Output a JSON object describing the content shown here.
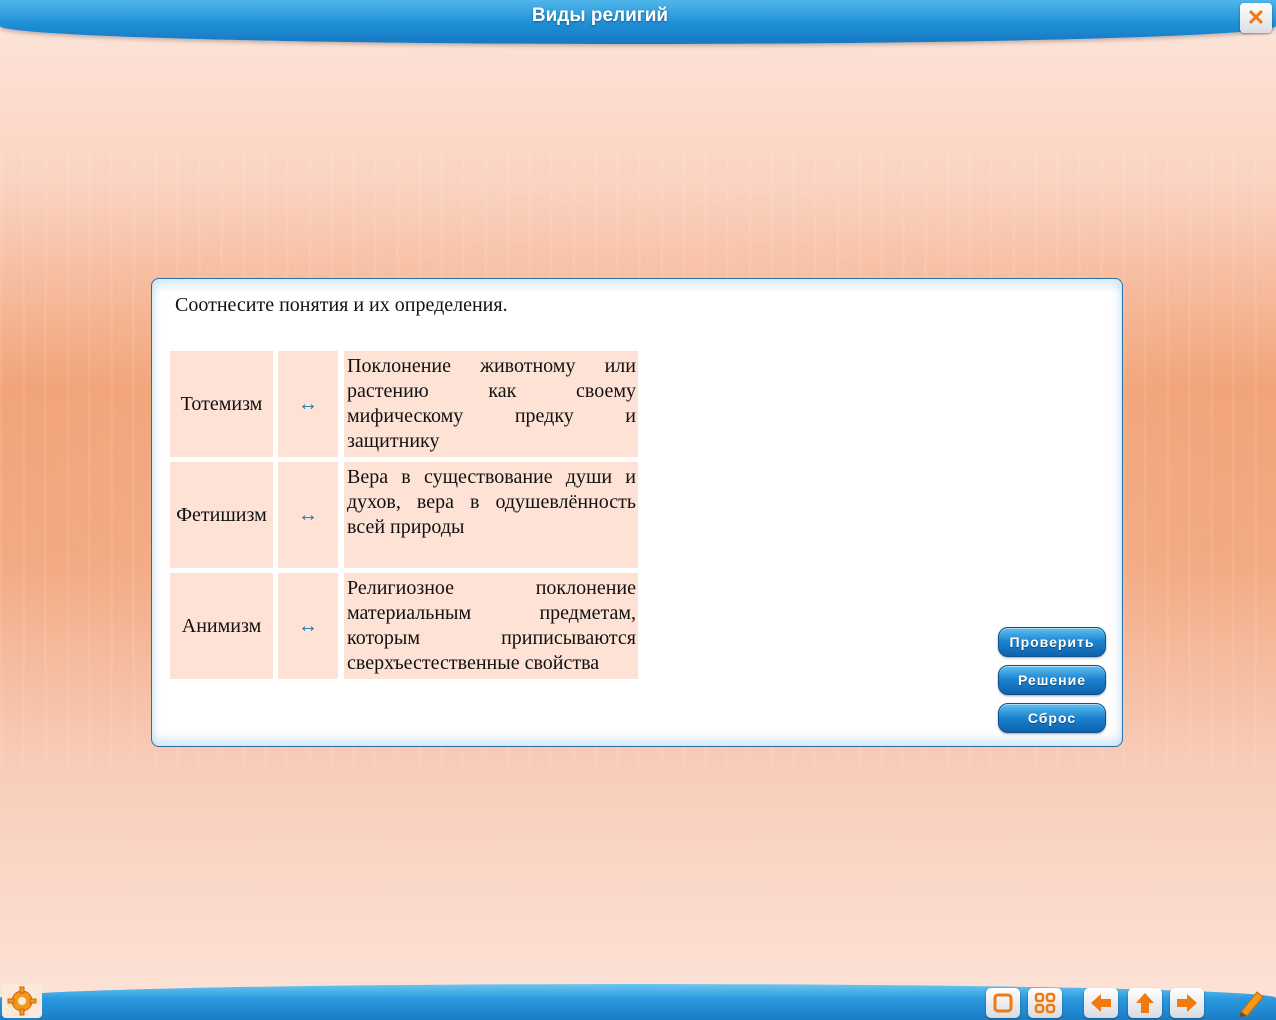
{
  "header": {
    "title": "Виды религий",
    "close_icon": "close-icon"
  },
  "panel": {
    "instruction": "Соотнесите понятия и их определения.",
    "rows": [
      {
        "term": "Тотемизм",
        "definition": "Поклонение животному или растению как своему мифическому предку и защитнику"
      },
      {
        "term": "Фетишизм",
        "definition": "Вера в существование души и духов, вера в одушевлённость всей природы"
      },
      {
        "term": "Анимизм",
        "definition": "Религиозное поклонение материальным предметам, которым приписываются сверхъестественные свойства"
      }
    ],
    "arrow_glyph": "↔"
  },
  "buttons": {
    "check": "Проверить",
    "solution": "Решение",
    "reset": "Сброс"
  },
  "colors": {
    "header_blue": "#1e8fd6",
    "cell_bg": "#fde2d5",
    "arrow": "#1b79a6",
    "accent_orange": "#f07a10"
  }
}
